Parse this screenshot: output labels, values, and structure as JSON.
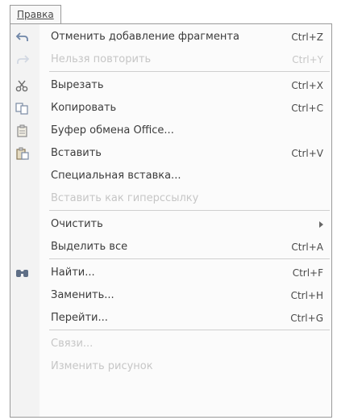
{
  "menu": {
    "title": "Правка"
  },
  "items": [
    {
      "label": "Отменить добавление фрагмента",
      "shortcut": "Ctrl+Z",
      "icon": "undo-icon"
    },
    {
      "label": "Нельзя повторить",
      "shortcut": "Ctrl+Y",
      "icon": "redo-icon"
    },
    {
      "label": "Вырезать",
      "shortcut": "Ctrl+X",
      "icon": "scissors-icon"
    },
    {
      "label": "Копировать",
      "shortcut": "Ctrl+C",
      "icon": "copy-icon"
    },
    {
      "label": "Буфер обмена Office...",
      "shortcut": "",
      "icon": "clipboard-icon"
    },
    {
      "label": "Вставить",
      "shortcut": "Ctrl+V",
      "icon": "paste-icon"
    },
    {
      "label": "Специальная вставка...",
      "shortcut": ""
    },
    {
      "label": "Вставить как гиперссылку",
      "shortcut": ""
    },
    {
      "label": "Очистить",
      "shortcut": ""
    },
    {
      "label": "Выделить все",
      "shortcut": "Ctrl+A"
    },
    {
      "label": "Найти...",
      "shortcut": "Ctrl+F",
      "icon": "find-icon"
    },
    {
      "label": "Заменить...",
      "shortcut": "Ctrl+H"
    },
    {
      "label": "Перейти...",
      "shortcut": "Ctrl+G"
    },
    {
      "label": "Связи...",
      "shortcut": ""
    },
    {
      "label": "Изменить рисунок",
      "shortcut": ""
    }
  ],
  "colors": {
    "text": "#3c3c3c",
    "disabled": "#c6c6c6",
    "border": "#9a9a9a",
    "icon_column": "#f3f3f3"
  }
}
